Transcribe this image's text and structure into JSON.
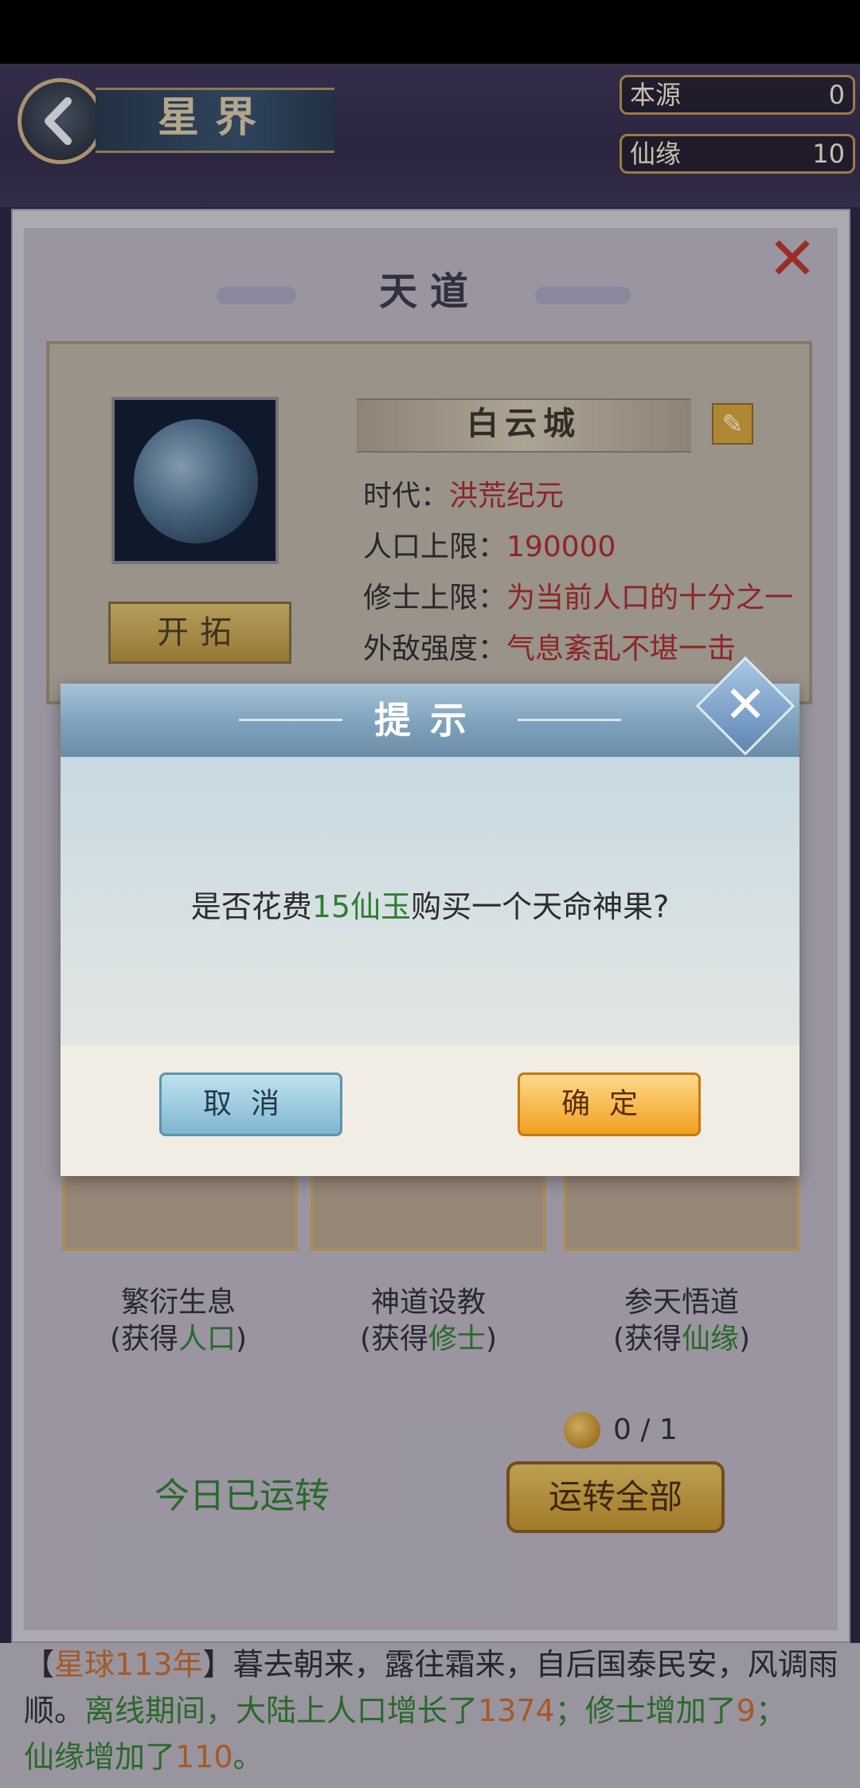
{
  "header": {
    "title": "星界",
    "back_icon": "chevron-left-icon"
  },
  "resources": [
    {
      "label": "本源",
      "value": "0"
    },
    {
      "label": "仙缘",
      "value": "10"
    }
  ],
  "panel": {
    "title": "天道",
    "close_icon": "close-icon",
    "world_name": "白云城",
    "edit_icon": "pencil-icon",
    "explore_label": "开拓",
    "info": [
      {
        "label": "时代：",
        "value": "洪荒纪元"
      },
      {
        "label": "人口上限：",
        "value": "190000"
      },
      {
        "label": "修士上限：",
        "value": "为当前人口的十分之一"
      },
      {
        "label": "外敌强度：",
        "value": "气息紊乱不堪一击"
      }
    ]
  },
  "options": [
    {
      "title": "繁衍生息",
      "prefix": "(获得",
      "gain": "人口",
      "suffix": ")"
    },
    {
      "title": "神道设教",
      "prefix": "(获得",
      "gain": "修士",
      "suffix": ")"
    },
    {
      "title": "参天悟道",
      "prefix": "(获得",
      "gain": "仙缘",
      "suffix": ")"
    }
  ],
  "fruit": {
    "count": "0 / 1",
    "icon": "fruit-icon"
  },
  "status_text": "今日已运转",
  "run_all_label": "运转全部",
  "log": {
    "bracket_open": "【",
    "year": "星球113年",
    "bracket_close": "】",
    "text1": "暮去朝来，露往霜来，自后国泰民安，风调雨顺。",
    "text2a": "离线期间，大陆上人口增长了",
    "pop": "1374",
    "text2b": "；修士增加了",
    "cult": "9",
    "text2c": "；",
    "text3a": "仙缘增加了",
    "fate": "110",
    "text3b": "。"
  },
  "dialog": {
    "title": "提示",
    "close_icon": "close-icon",
    "msg_before": "是否花费",
    "msg_cost": "15仙玉",
    "msg_after": "购买一个天命神果?",
    "cancel_label": "取消",
    "confirm_label": "确定"
  },
  "colors": {
    "accent_green": "#2e7d2e",
    "accent_red": "#a62a2a",
    "log_orange": "#c46a2a",
    "confirm_orange": "#f0a020",
    "cancel_blue": "#7fb6cf"
  }
}
